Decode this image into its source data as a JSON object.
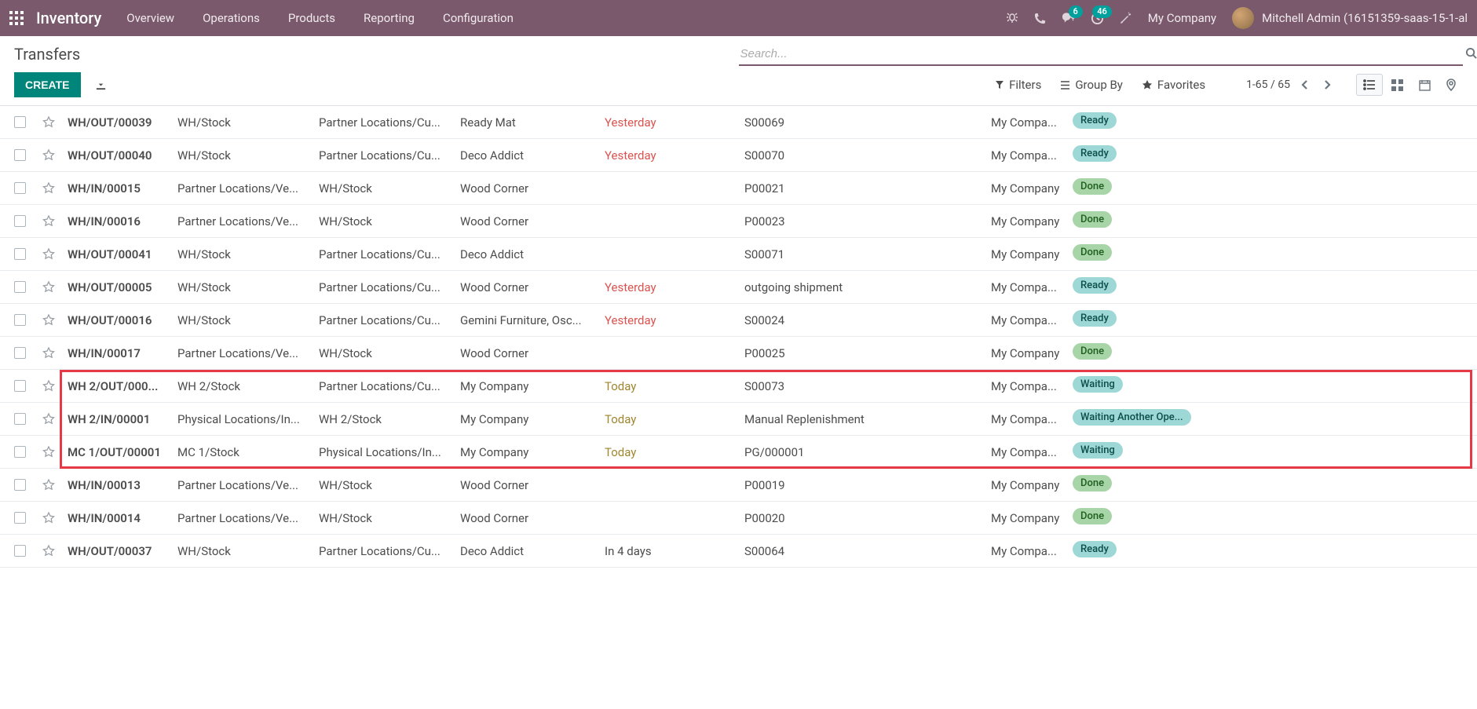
{
  "navbar": {
    "brand": "Inventory",
    "menu": [
      "Overview",
      "Operations",
      "Products",
      "Reporting",
      "Configuration"
    ],
    "messaging_badge": "6",
    "activities_badge": "46",
    "company": "My Company",
    "user": "Mitchell Admin (16151359-saas-15-1-al"
  },
  "control_panel": {
    "breadcrumb": "Transfers",
    "search_placeholder": "Search...",
    "create_label": "CREATE",
    "filters_label": "Filters",
    "groupby_label": "Group By",
    "favorites_label": "Favorites",
    "pager": "1-65 / 65"
  },
  "rows": [
    {
      "ref": "WH/OUT/00039",
      "from": "WH/Stock",
      "to": "Partner Locations/Cu...",
      "contact": "Ready Mat",
      "date": "Yesterday",
      "date_class": "date-past",
      "src": "S00069",
      "company": "My Compa...",
      "status": "Ready",
      "status_class": "status-ready"
    },
    {
      "ref": "WH/OUT/00040",
      "from": "WH/Stock",
      "to": "Partner Locations/Cu...",
      "contact": "Deco Addict",
      "date": "Yesterday",
      "date_class": "date-past",
      "src": "S00070",
      "company": "My Compa...",
      "status": "Ready",
      "status_class": "status-ready"
    },
    {
      "ref": "WH/IN/00015",
      "from": "Partner Locations/Ve...",
      "to": "WH/Stock",
      "contact": "Wood Corner",
      "date": "",
      "date_class": "",
      "src": "P00021",
      "company": "My Company",
      "status": "Done",
      "status_class": "status-done"
    },
    {
      "ref": "WH/IN/00016",
      "from": "Partner Locations/Ve...",
      "to": "WH/Stock",
      "contact": "Wood Corner",
      "date": "",
      "date_class": "",
      "src": "P00023",
      "company": "My Company",
      "status": "Done",
      "status_class": "status-done"
    },
    {
      "ref": "WH/OUT/00041",
      "from": "WH/Stock",
      "to": "Partner Locations/Cu...",
      "contact": "Deco Addict",
      "date": "",
      "date_class": "",
      "src": "S00071",
      "company": "My Company",
      "status": "Done",
      "status_class": "status-done"
    },
    {
      "ref": "WH/OUT/00005",
      "from": "WH/Stock",
      "to": "Partner Locations/Cu...",
      "contact": "Wood Corner",
      "date": "Yesterday",
      "date_class": "date-past",
      "src": "outgoing shipment",
      "company": "My Compa...",
      "status": "Ready",
      "status_class": "status-ready"
    },
    {
      "ref": "WH/OUT/00016",
      "from": "WH/Stock",
      "to": "Partner Locations/Cu...",
      "contact": "Gemini Furniture, Osc...",
      "date": "Yesterday",
      "date_class": "date-past",
      "src": "S00024",
      "company": "My Compa...",
      "status": "Ready",
      "status_class": "status-ready"
    },
    {
      "ref": "WH/IN/00017",
      "from": "Partner Locations/Ve...",
      "to": "WH/Stock",
      "contact": "Wood Corner",
      "date": "",
      "date_class": "",
      "src": "P00025",
      "company": "My Company",
      "status": "Done",
      "status_class": "status-done"
    },
    {
      "ref": "WH 2/OUT/000...",
      "from": "WH 2/Stock",
      "to": "Partner Locations/Cu...",
      "contact": "My Company",
      "date": "Today",
      "date_class": "date-today",
      "src": "S00073",
      "company": "My Compa...",
      "status": "Waiting",
      "status_class": "status-waiting",
      "highlighted": true,
      "highlight_start": true
    },
    {
      "ref": "WH 2/IN/00001",
      "from": "Physical Locations/In...",
      "to": "WH 2/Stock",
      "contact": "My Company",
      "date": "Today",
      "date_class": "date-today",
      "src": "Manual Replenishment",
      "company": "My Compa...",
      "status": "Waiting Another Ope...",
      "status_class": "status-waiting",
      "highlighted": true
    },
    {
      "ref": "MC 1/OUT/00001",
      "from": "MC 1/Stock",
      "to": "Physical Locations/In...",
      "contact": "My Company",
      "date": "Today",
      "date_class": "date-today",
      "src": "PG/000001",
      "company": "My Compa...",
      "status": "Waiting",
      "status_class": "status-waiting",
      "highlighted": true,
      "highlight_end": true
    },
    {
      "ref": "WH/IN/00013",
      "from": "Partner Locations/Ve...",
      "to": "WH/Stock",
      "contact": "Wood Corner",
      "date": "",
      "date_class": "",
      "src": "P00019",
      "company": "My Company",
      "status": "Done",
      "status_class": "status-done"
    },
    {
      "ref": "WH/IN/00014",
      "from": "Partner Locations/Ve...",
      "to": "WH/Stock",
      "contact": "Wood Corner",
      "date": "",
      "date_class": "",
      "src": "P00020",
      "company": "My Company",
      "status": "Done",
      "status_class": "status-done"
    },
    {
      "ref": "WH/OUT/00037",
      "from": "WH/Stock",
      "to": "Partner Locations/Cu...",
      "contact": "Deco Addict",
      "date": "In 4 days",
      "date_class": "",
      "src": "S00064",
      "company": "My Compa...",
      "status": "Ready",
      "status_class": "status-ready"
    }
  ]
}
